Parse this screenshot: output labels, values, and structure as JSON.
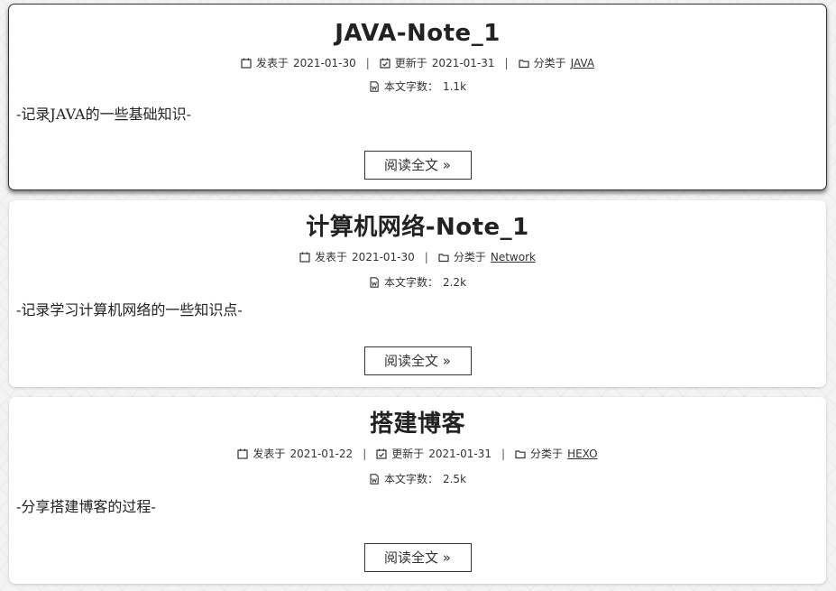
{
  "labels": {
    "posted": "发表于",
    "updated": "更新于",
    "category": "分类于",
    "wordcount": "本文字数：",
    "read_more": "阅读全文 »",
    "sep": "|"
  },
  "posts": [
    {
      "title": "JAVA-Note_1",
      "posted_date": "2021-01-30",
      "updated_date": "2021-01-31",
      "category": "JAVA",
      "wordcount": "1.1k",
      "excerpt": "-记录JAVA的一些基础知识-"
    },
    {
      "title": "计算机网络-Note_1",
      "posted_date": "2021-01-30",
      "category": "Network",
      "wordcount": "2.2k",
      "excerpt": "-记录学习计算机网络的一些知识点-"
    },
    {
      "title": "搭建博客",
      "posted_date": "2021-01-22",
      "updated_date": "2021-01-31",
      "category": "HEXO",
      "wordcount": "2.5k",
      "excerpt": "-分享搭建博客的过程-"
    }
  ]
}
